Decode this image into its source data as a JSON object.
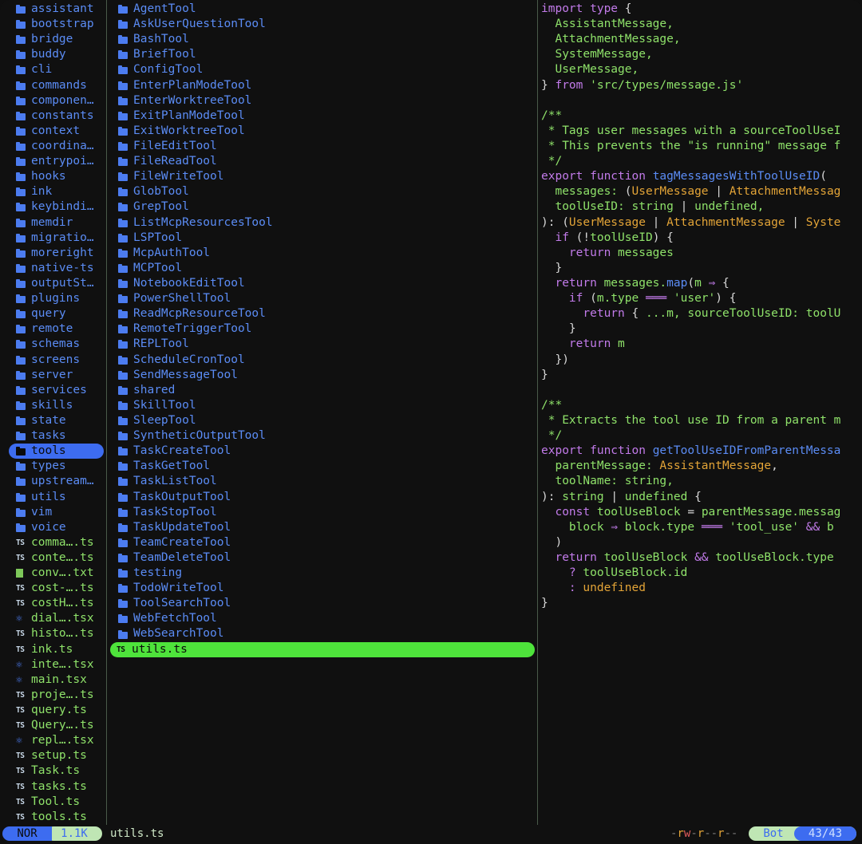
{
  "left_pane": {
    "items": [
      {
        "name": "assistant",
        "kind": "dir"
      },
      {
        "name": "bootstrap",
        "kind": "dir"
      },
      {
        "name": "bridge",
        "kind": "dir"
      },
      {
        "name": "buddy",
        "kind": "dir"
      },
      {
        "name": "cli",
        "kind": "dir"
      },
      {
        "name": "commands",
        "kind": "dir"
      },
      {
        "name": "componen…",
        "kind": "dir"
      },
      {
        "name": "constants",
        "kind": "dir"
      },
      {
        "name": "context",
        "kind": "dir"
      },
      {
        "name": "coordina…",
        "kind": "dir"
      },
      {
        "name": "entrypoi…",
        "kind": "dir"
      },
      {
        "name": "hooks",
        "kind": "dir"
      },
      {
        "name": "ink",
        "kind": "dir"
      },
      {
        "name": "keybindi…",
        "kind": "dir"
      },
      {
        "name": "memdir",
        "kind": "dir"
      },
      {
        "name": "migratio…",
        "kind": "dir"
      },
      {
        "name": "moreright",
        "kind": "dir"
      },
      {
        "name": "native-ts",
        "kind": "dir"
      },
      {
        "name": "outputSt…",
        "kind": "dir"
      },
      {
        "name": "plugins",
        "kind": "dir"
      },
      {
        "name": "query",
        "kind": "dir"
      },
      {
        "name": "remote",
        "kind": "dir"
      },
      {
        "name": "schemas",
        "kind": "dir"
      },
      {
        "name": "screens",
        "kind": "dir"
      },
      {
        "name": "server",
        "kind": "dir"
      },
      {
        "name": "services",
        "kind": "dir"
      },
      {
        "name": "skills",
        "kind": "dir"
      },
      {
        "name": "state",
        "kind": "dir"
      },
      {
        "name": "tasks",
        "kind": "dir"
      },
      {
        "name": "tools",
        "kind": "dir",
        "selected": true
      },
      {
        "name": "types",
        "kind": "dir"
      },
      {
        "name": "upstream…",
        "kind": "dir"
      },
      {
        "name": "utils",
        "kind": "dir"
      },
      {
        "name": "vim",
        "kind": "dir"
      },
      {
        "name": "voice",
        "kind": "dir"
      },
      {
        "name": "comma….ts",
        "kind": "ts"
      },
      {
        "name": "conte….ts",
        "kind": "ts"
      },
      {
        "name": "conv….txt",
        "kind": "txt"
      },
      {
        "name": "cost-….ts",
        "kind": "ts"
      },
      {
        "name": "costH….ts",
        "kind": "ts"
      },
      {
        "name": "dial….tsx",
        "kind": "tsx"
      },
      {
        "name": "histo….ts",
        "kind": "ts"
      },
      {
        "name": "ink.ts",
        "kind": "ts"
      },
      {
        "name": "inte….tsx",
        "kind": "tsx"
      },
      {
        "name": "main.tsx",
        "kind": "tsx"
      },
      {
        "name": "proje….ts",
        "kind": "ts"
      },
      {
        "name": "query.ts",
        "kind": "ts"
      },
      {
        "name": "Query….ts",
        "kind": "ts"
      },
      {
        "name": "repl….tsx",
        "kind": "tsx"
      },
      {
        "name": "setup.ts",
        "kind": "ts"
      },
      {
        "name": "Task.ts",
        "kind": "ts"
      },
      {
        "name": "tasks.ts",
        "kind": "ts"
      },
      {
        "name": "Tool.ts",
        "kind": "ts"
      },
      {
        "name": "tools.ts",
        "kind": "ts"
      }
    ]
  },
  "middle_pane": {
    "items": [
      {
        "name": "AgentTool",
        "kind": "dir"
      },
      {
        "name": "AskUserQuestionTool",
        "kind": "dir"
      },
      {
        "name": "BashTool",
        "kind": "dir"
      },
      {
        "name": "BriefTool",
        "kind": "dir"
      },
      {
        "name": "ConfigTool",
        "kind": "dir"
      },
      {
        "name": "EnterPlanModeTool",
        "kind": "dir"
      },
      {
        "name": "EnterWorktreeTool",
        "kind": "dir"
      },
      {
        "name": "ExitPlanModeTool",
        "kind": "dir"
      },
      {
        "name": "ExitWorktreeTool",
        "kind": "dir"
      },
      {
        "name": "FileEditTool",
        "kind": "dir"
      },
      {
        "name": "FileReadTool",
        "kind": "dir"
      },
      {
        "name": "FileWriteTool",
        "kind": "dir"
      },
      {
        "name": "GlobTool",
        "kind": "dir"
      },
      {
        "name": "GrepTool",
        "kind": "dir"
      },
      {
        "name": "ListMcpResourcesTool",
        "kind": "dir"
      },
      {
        "name": "LSPTool",
        "kind": "dir"
      },
      {
        "name": "McpAuthTool",
        "kind": "dir"
      },
      {
        "name": "MCPTool",
        "kind": "dir"
      },
      {
        "name": "NotebookEditTool",
        "kind": "dir"
      },
      {
        "name": "PowerShellTool",
        "kind": "dir"
      },
      {
        "name": "ReadMcpResourceTool",
        "kind": "dir"
      },
      {
        "name": "RemoteTriggerTool",
        "kind": "dir"
      },
      {
        "name": "REPLTool",
        "kind": "dir"
      },
      {
        "name": "ScheduleCronTool",
        "kind": "dir"
      },
      {
        "name": "SendMessageTool",
        "kind": "dir"
      },
      {
        "name": "shared",
        "kind": "dir"
      },
      {
        "name": "SkillTool",
        "kind": "dir"
      },
      {
        "name": "SleepTool",
        "kind": "dir"
      },
      {
        "name": "SyntheticOutputTool",
        "kind": "dir"
      },
      {
        "name": "TaskCreateTool",
        "kind": "dir"
      },
      {
        "name": "TaskGetTool",
        "kind": "dir"
      },
      {
        "name": "TaskListTool",
        "kind": "dir"
      },
      {
        "name": "TaskOutputTool",
        "kind": "dir"
      },
      {
        "name": "TaskStopTool",
        "kind": "dir"
      },
      {
        "name": "TaskUpdateTool",
        "kind": "dir"
      },
      {
        "name": "TeamCreateTool",
        "kind": "dir"
      },
      {
        "name": "TeamDeleteTool",
        "kind": "dir"
      },
      {
        "name": "testing",
        "kind": "dir"
      },
      {
        "name": "TodoWriteTool",
        "kind": "dir"
      },
      {
        "name": "ToolSearchTool",
        "kind": "dir"
      },
      {
        "name": "WebFetchTool",
        "kind": "dir"
      },
      {
        "name": "WebSearchTool",
        "kind": "dir"
      },
      {
        "name": "utils.ts",
        "kind": "ts",
        "selected": true
      }
    ]
  },
  "code_lines": [
    [
      [
        "kw",
        "import type "
      ],
      [
        "cw",
        "{"
      ]
    ],
    [
      [
        "pl",
        "  AssistantMessage,"
      ]
    ],
    [
      [
        "pl",
        "  AttachmentMessage,"
      ]
    ],
    [
      [
        "pl",
        "  SystemMessage,"
      ]
    ],
    [
      [
        "pl",
        "  UserMessage,"
      ]
    ],
    [
      [
        "cw",
        "} "
      ],
      [
        "kw",
        "from "
      ],
      [
        "str",
        "'src/types/message.js'"
      ]
    ],
    [
      [
        "cw",
        ""
      ]
    ],
    [
      [
        "cm",
        "/**"
      ]
    ],
    [
      [
        "cm",
        " * Tags user messages with a sourceToolUseI"
      ]
    ],
    [
      [
        "cm",
        " * This prevents the \"is running\" message f"
      ]
    ],
    [
      [
        "cm",
        " */"
      ]
    ],
    [
      [
        "kw",
        "export function "
      ],
      [
        "fn",
        "tagMessagesWithToolUseID"
      ],
      [
        "cw",
        "("
      ]
    ],
    [
      [
        "pl",
        "  messages: "
      ],
      [
        "cw",
        "("
      ],
      [
        "ty",
        "UserMessage"
      ],
      [
        "cw",
        " | "
      ],
      [
        "ty",
        "AttachmentMessag"
      ]
    ],
    [
      [
        "pl",
        "  toolUseID: "
      ],
      [
        "pl",
        "string"
      ],
      [
        "cw",
        " | "
      ],
      [
        "pl",
        "undefined,"
      ]
    ],
    [
      [
        "cw",
        "): ("
      ],
      [
        "ty",
        "UserMessage"
      ],
      [
        "cw",
        " | "
      ],
      [
        "ty",
        "AttachmentMessage"
      ],
      [
        "cw",
        " | "
      ],
      [
        "ty",
        "Syste"
      ]
    ],
    [
      [
        "kw",
        "  if "
      ],
      [
        "cw",
        "(!"
      ],
      [
        "pl",
        "toolUseID"
      ],
      [
        "cw",
        ") {"
      ]
    ],
    [
      [
        "kw",
        "    return "
      ],
      [
        "pl",
        "messages"
      ]
    ],
    [
      [
        "cw",
        "  }"
      ]
    ],
    [
      [
        "kw",
        "  return "
      ],
      [
        "pl",
        "messages."
      ],
      [
        "fn",
        "map"
      ],
      [
        "cw",
        "("
      ],
      [
        "pl",
        "m "
      ],
      [
        "op",
        "⇒ "
      ],
      [
        "cw",
        "{"
      ]
    ],
    [
      [
        "kw",
        "    if "
      ],
      [
        "cw",
        "("
      ],
      [
        "pl",
        "m.type "
      ],
      [
        "op",
        "═══ "
      ],
      [
        "str",
        "'user'"
      ],
      [
        "cw",
        ") {"
      ]
    ],
    [
      [
        "kw",
        "      return "
      ],
      [
        "cw",
        "{ "
      ],
      [
        "pl",
        "...m, sourceToolUseID: toolU"
      ]
    ],
    [
      [
        "cw",
        "    }"
      ]
    ],
    [
      [
        "kw",
        "    return "
      ],
      [
        "pl",
        "m"
      ]
    ],
    [
      [
        "cw",
        "  })"
      ]
    ],
    [
      [
        "cw",
        "}"
      ]
    ],
    [
      [
        "cw",
        ""
      ]
    ],
    [
      [
        "cm",
        "/**"
      ]
    ],
    [
      [
        "cm",
        " * Extracts the tool use ID from a parent m"
      ]
    ],
    [
      [
        "cm",
        " */"
      ]
    ],
    [
      [
        "kw",
        "export function "
      ],
      [
        "fn",
        "getToolUseIDFromParentMessa"
      ]
    ],
    [
      [
        "pl",
        "  parentMessage: "
      ],
      [
        "ty",
        "AssistantMessage"
      ],
      [
        "cw",
        ","
      ]
    ],
    [
      [
        "pl",
        "  toolName: string,"
      ]
    ],
    [
      [
        "cw",
        "): "
      ],
      [
        "pl",
        "string"
      ],
      [
        "cw",
        " | "
      ],
      [
        "pl",
        "undefined "
      ],
      [
        "cw",
        "{"
      ]
    ],
    [
      [
        "kw",
        "  const "
      ],
      [
        "pl",
        "toolUseBlock "
      ],
      [
        "cw",
        "= "
      ],
      [
        "pl",
        "parentMessage.messag"
      ]
    ],
    [
      [
        "pl",
        "    block "
      ],
      [
        "op",
        "⇒ "
      ],
      [
        "pl",
        "block.type "
      ],
      [
        "op",
        "═══ "
      ],
      [
        "str",
        "'tool_use' "
      ],
      [
        "op",
        "&& "
      ],
      [
        "pl",
        "b"
      ]
    ],
    [
      [
        "cw",
        "  )"
      ]
    ],
    [
      [
        "kw",
        "  return "
      ],
      [
        "pl",
        "toolUseBlock "
      ],
      [
        "op",
        "&& "
      ],
      [
        "pl",
        "toolUseBlock.type"
      ]
    ],
    [
      [
        "op",
        "    ? "
      ],
      [
        "pl",
        "toolUseBlock.id"
      ]
    ],
    [
      [
        "op",
        "    : "
      ],
      [
        "ty",
        "undefined"
      ]
    ],
    [
      [
        "cw",
        "}"
      ]
    ]
  ],
  "status": {
    "mode": "NOR",
    "size": "1.1K",
    "filename": "utils.ts",
    "perm_parts": [
      [
        "d",
        "-"
      ],
      [
        "r",
        "r"
      ],
      [
        "w",
        "w"
      ],
      [
        "d",
        "-"
      ],
      [
        "r",
        "r"
      ],
      [
        "d",
        "--"
      ],
      [
        "r",
        "r"
      ],
      [
        "d",
        "--"
      ]
    ],
    "position_label": "Bot",
    "position": "43/43"
  },
  "colors": {
    "dir": "#5b8cf5",
    "file": "#8fe26a",
    "keyword": "#c27bea",
    "type": "#e3a437",
    "selection_left": "#3d6cf0",
    "selection_mid": "#4ee33b"
  }
}
